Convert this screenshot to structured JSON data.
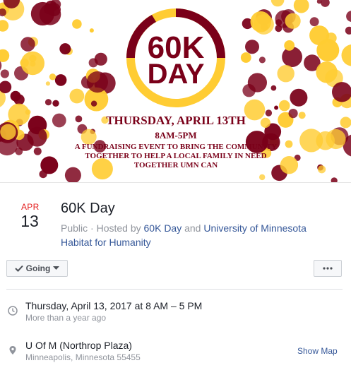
{
  "banner": {
    "headline": "60K",
    "headline2": "DAY",
    "date_line": "THURSDAY, APRIL 13TH",
    "time_line": "8AM-5PM",
    "tagline1": "A FUNDRAISING EVENT TO BRING THE COMMUNITY",
    "tagline2": "TOGETHER TO HELP A LOCAL FAMILY IN NEED",
    "tagline3": "TOGETHER UMN CAN",
    "colors": {
      "maroon": "#7a0019",
      "gold": "#ffcc33"
    }
  },
  "event": {
    "month": "APR",
    "day": "13",
    "title": "60K Day",
    "visibility": "Public",
    "hosted_by_text": "· Hosted by",
    "host1": "60K Day",
    "and_text": "and",
    "host2": "University of Minnesota Habitat for Humanity"
  },
  "actions": {
    "going_label": "Going",
    "check_icon": "check-icon",
    "caret_icon": "caret-down-icon",
    "more_icon": "more-dots-icon"
  },
  "details": {
    "when": "Thursday, April 13, 2017 at 8 AM – 5 PM",
    "when_sub": "More than a year ago",
    "where": "U Of M (Northrop Plaza)",
    "where_sub": "Minneapolis, Minnesota 55455",
    "show_map": "Show Map",
    "clock_icon": "clock-icon",
    "pin_icon": "map-pin-icon"
  }
}
